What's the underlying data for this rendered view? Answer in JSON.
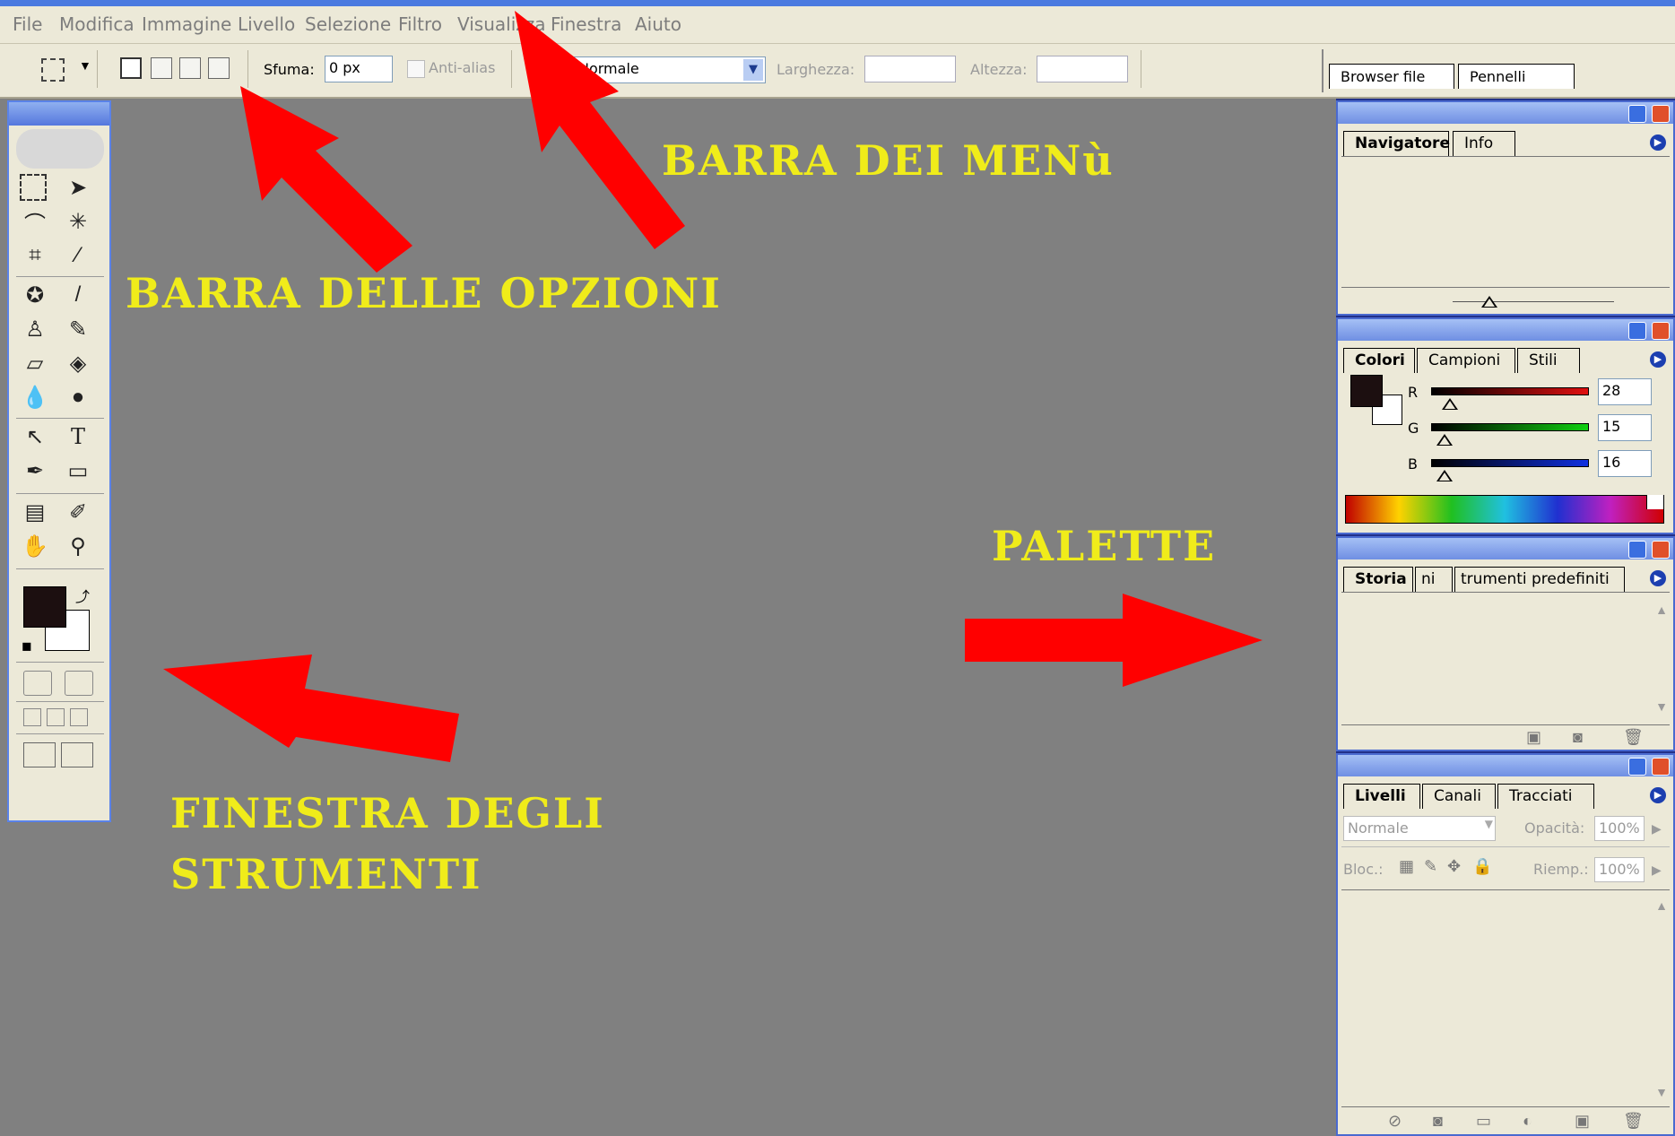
{
  "menubar": {
    "items": [
      "File",
      "Modifica",
      "Immagine",
      "Livello",
      "Selezione",
      "Filtro",
      "Visualizza",
      "Finestra",
      "Aiuto"
    ]
  },
  "options": {
    "feather_label": "Sfuma:",
    "feather_value": "0 px",
    "antialias_label": "Anti-alias",
    "style_value": "Normale",
    "width_label": "Larghezza:",
    "height_label": "Altezza:"
  },
  "tabwell": {
    "tabs": [
      "Browser file",
      "Pennelli"
    ]
  },
  "annotations": {
    "menu_bar": "BARRA DEI MENù",
    "options_bar": "BARRA DELLE OPZIONI",
    "palette": "PALETTE",
    "toolbox_line1": "FINESTRA DEGLI",
    "toolbox_line2": "STRUMENTI"
  },
  "navigator": {
    "tabs": [
      "Navigatore",
      "Info"
    ]
  },
  "colors_palette": {
    "tabs": [
      "Colori",
      "Campioni",
      "Stili"
    ],
    "r_label": "R",
    "r_value": "28",
    "g_label": "G",
    "g_value": "15",
    "b_label": "B",
    "b_value": "16",
    "foreground": "#1c0f10"
  },
  "history": {
    "tabs": [
      "Storia",
      "ni",
      "trumenti predefiniti"
    ]
  },
  "layers": {
    "tabs": [
      "Livelli",
      "Canali",
      "Tracciati"
    ],
    "blend_mode": "Normale",
    "opacity_label": "Opacità:",
    "opacity_value": "100%",
    "lock_label": "Bloc.:",
    "fill_label": "Riemp.:",
    "fill_value": "100%"
  },
  "colors": {
    "workspace": "#808080",
    "annotation": "#f0ec1a",
    "arrow": "#ff0000",
    "background": "#22318a"
  }
}
